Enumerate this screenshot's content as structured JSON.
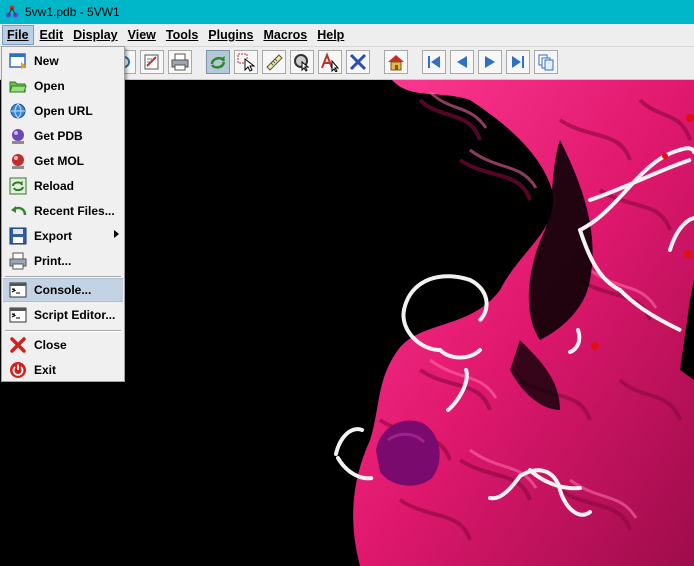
{
  "window": {
    "title": "5vw1.pdb - 5VW1"
  },
  "menubar": [
    {
      "label": "File",
      "mnemonic_index": 0,
      "active": true
    },
    {
      "label": "Edit",
      "mnemonic_index": 0
    },
    {
      "label": "Display",
      "mnemonic_index": 0
    },
    {
      "label": "View",
      "mnemonic_index": 0
    },
    {
      "label": "Tools",
      "mnemonic_index": 0
    },
    {
      "label": "Plugins",
      "mnemonic_index": 0
    },
    {
      "label": "Macros",
      "mnemonic_index": 0
    },
    {
      "label": "Help",
      "mnemonic_index": 0
    }
  ],
  "toolbar": {
    "buttons": [
      {
        "icon": "zoom-icon"
      },
      {
        "icon": "edit-script-icon"
      },
      {
        "icon": "print-icon"
      },
      {
        "icon": "rotate-icon",
        "selected": true
      },
      {
        "icon": "pick-icon"
      },
      {
        "icon": "measure-ruler-icon"
      },
      {
        "icon": "spin-icon"
      },
      {
        "icon": "label-atom-icon"
      },
      {
        "icon": "drag-move-icon"
      },
      {
        "icon": "home-icon"
      },
      {
        "icon": "first-frame-icon"
      },
      {
        "icon": "previous-frame-icon"
      },
      {
        "icon": "next-frame-icon"
      },
      {
        "icon": "last-frame-icon"
      },
      {
        "icon": "copy-frames-icon"
      }
    ]
  },
  "file_menu": {
    "items": {
      "new": {
        "label": "New",
        "icon": "new-file-icon"
      },
      "open": {
        "label": "Open",
        "icon": "open-folder-icon"
      },
      "open_url": {
        "label": "Open URL",
        "icon": "globe-icon"
      },
      "get_pdb": {
        "label": "Get PDB",
        "icon": "pdb-molecule-icon"
      },
      "get_mol": {
        "label": "Get MOL",
        "icon": "mol-molecule-icon"
      },
      "reload": {
        "label": "Reload",
        "icon": "reload-icon"
      },
      "recent_files": {
        "label": "Recent Files...",
        "icon": "recent-files-icon"
      },
      "export": {
        "label": "Export",
        "icon": "floppy-disk-icon",
        "has_submenu": true
      },
      "print": {
        "label": "Print...",
        "icon": "printer-icon"
      },
      "console": {
        "label": "Console...",
        "icon": "console-icon",
        "highlighted": true
      },
      "script_editor": {
        "label": "Script Editor...",
        "icon": "script-editor-icon"
      },
      "close": {
        "label": "Close",
        "icon": "close-x-icon"
      },
      "exit": {
        "label": "Exit",
        "icon": "power-icon"
      }
    }
  },
  "colors": {
    "titlebar": "#00b7c9",
    "ribbon": "#e0186e",
    "ribbon_dark": "#a30c4d",
    "coil": "#f2f2f2",
    "heme": "#7a0a6e",
    "menu_highlight": "#c3d3e4"
  }
}
